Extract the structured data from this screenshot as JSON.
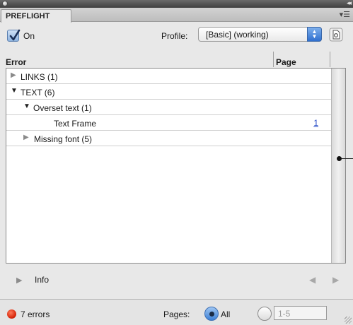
{
  "panel": {
    "tab_label": "PREFLIGHT",
    "on_label": "On",
    "profile_label": "Profile:",
    "profile_value": "[Basic] (working)"
  },
  "table": {
    "columns": [
      "Error",
      "Page"
    ],
    "rows": [
      {
        "label": "LINKS (1)",
        "state": "collapsed",
        "indent": 0,
        "page": ""
      },
      {
        "label": "TEXT (6)",
        "state": "expanded",
        "indent": 0,
        "page": ""
      },
      {
        "label": "Overset text (1)",
        "state": "expanded",
        "indent": 1,
        "page": ""
      },
      {
        "label": "Text Frame",
        "state": "leaf",
        "indent": 2,
        "page": "1"
      },
      {
        "label": "Missing font (5)",
        "state": "collapsed",
        "indent": 1,
        "page": ""
      }
    ]
  },
  "info": {
    "label": "Info"
  },
  "status": {
    "errors_text": "7 errors",
    "pages_label": "Pages:",
    "all_label": "All",
    "range_value": "1-5"
  },
  "colors": {
    "error_dot": "#d6260a",
    "link": "#2a4fc8",
    "accent": "#3c80d6"
  },
  "icons": [
    "close-icon",
    "collapse-panel-icon",
    "panel-menu-icon",
    "checkbox-checked-icon",
    "select-arrows-icon",
    "define-profiles-icon",
    "disclosure-triangle-icon",
    "previous-arrow-icon",
    "next-arrow-icon",
    "error-status-icon",
    "resize-grip-icon"
  ]
}
